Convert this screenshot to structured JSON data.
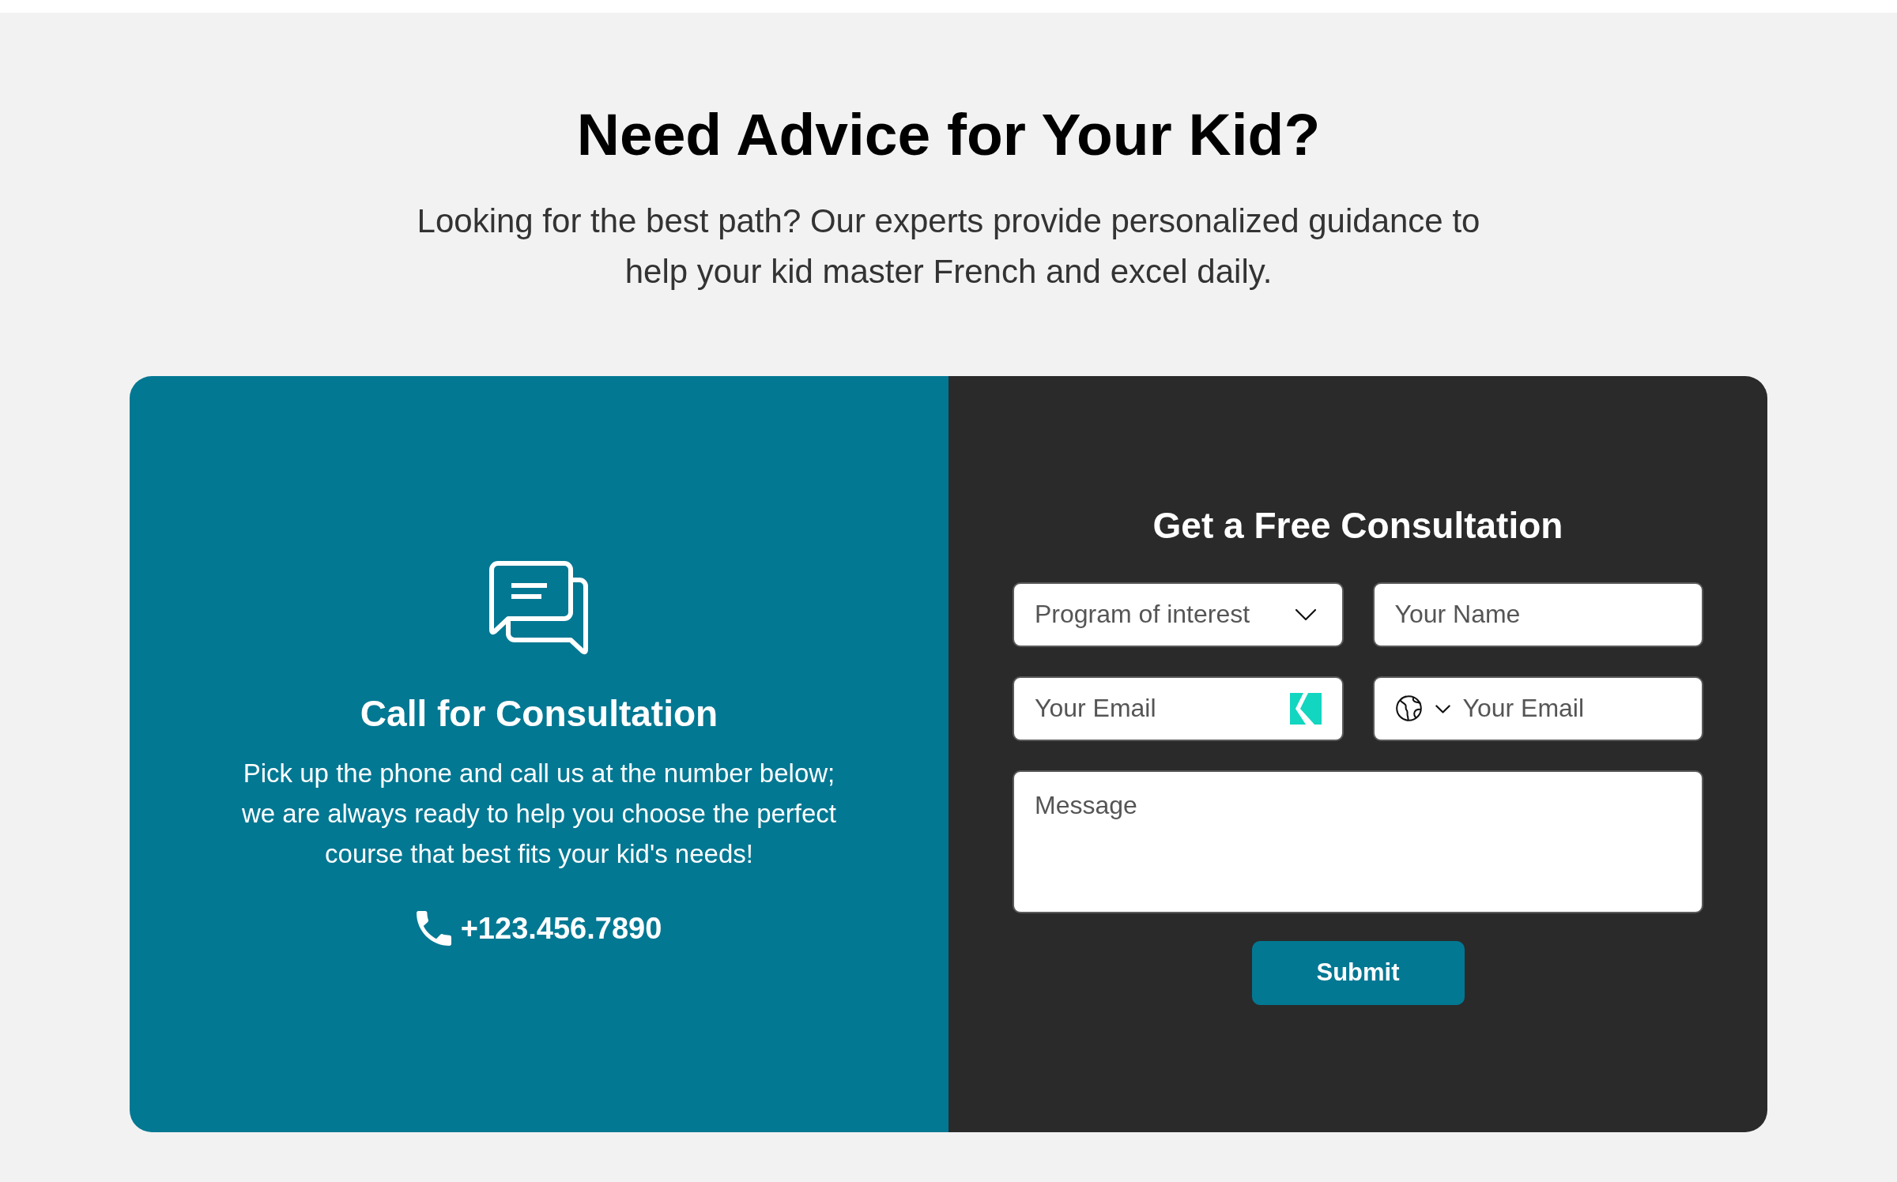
{
  "header": {
    "title": "Need Advice for Your Kid?",
    "subtitle": "Looking for the best path? Our experts provide personalized guidance to help your kid master French and excel daily."
  },
  "call_panel": {
    "title": "Call for Consultation",
    "description": "Pick up the phone and call us at the number below; we are always ready to help you choose the perfect course that best fits your kid's needs!",
    "phone": "+123.456.7890"
  },
  "form": {
    "title": "Get a Free Consultation",
    "fields": [
      {
        "kind": "select",
        "placeholder": "Program of interest"
      },
      {
        "kind": "text",
        "placeholder": "Your Name"
      },
      {
        "kind": "email",
        "placeholder": "Your Email"
      },
      {
        "kind": "phone",
        "placeholder": "Your Email"
      },
      {
        "kind": "textarea",
        "placeholder": "Message"
      }
    ],
    "submit": "Submit"
  }
}
